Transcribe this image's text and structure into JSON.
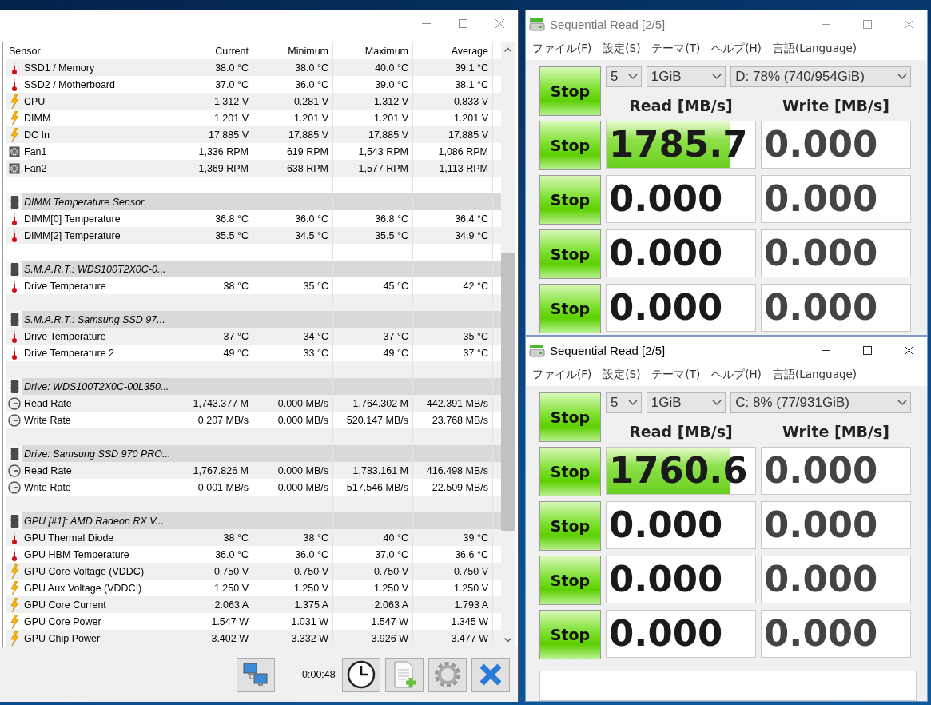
{
  "sensor_window": {
    "columns": [
      "Sensor",
      "Current",
      "Minimum",
      "Maximum",
      "Average"
    ],
    "rows": [
      {
        "kind": "temperature",
        "name": "SSD1 / Memory",
        "values": [
          "38.0 °C",
          "38.0 °C",
          "40.0 °C",
          "39.1 °C"
        ]
      },
      {
        "kind": "temperature",
        "name": "SSD2 / Motherboard",
        "values": [
          "37.0 °C",
          "36.0 °C",
          "39.0 °C",
          "38.1 °C"
        ]
      },
      {
        "kind": "voltage",
        "name": "CPU",
        "values": [
          "1.312 V",
          "0.281 V",
          "1.312 V",
          "0.833 V"
        ]
      },
      {
        "kind": "voltage",
        "name": "DIMM",
        "values": [
          "1.201 V",
          "1.201 V",
          "1.201 V",
          "1.201 V"
        ]
      },
      {
        "kind": "voltage",
        "name": "DC In",
        "values": [
          "17.885 V",
          "17.885 V",
          "17.885 V",
          "17.885 V"
        ]
      },
      {
        "kind": "fan",
        "name": "Fan1",
        "values": [
          "1,336 RPM",
          "619 RPM",
          "1,543 RPM",
          "1,086 RPM"
        ]
      },
      {
        "kind": "fan",
        "name": "Fan2",
        "values": [
          "1,369 RPM",
          "638 RPM",
          "1,577 RPM",
          "1,113 RPM"
        ]
      },
      {
        "kind": "blank"
      },
      {
        "kind": "group",
        "name": "DIMM Temperature Sensor"
      },
      {
        "kind": "temperature",
        "name": "DIMM[0] Temperature",
        "values": [
          "36.8 °C",
          "36.0 °C",
          "36.8 °C",
          "36.4 °C"
        ]
      },
      {
        "kind": "temperature",
        "name": "DIMM[2] Temperature",
        "values": [
          "35.5 °C",
          "34.5 °C",
          "35.5 °C",
          "34.9 °C"
        ]
      },
      {
        "kind": "blank"
      },
      {
        "kind": "group",
        "name": "S.M.A.R.T.: WDS100T2X0C-0..."
      },
      {
        "kind": "temperature",
        "name": "Drive Temperature",
        "values": [
          "38 °C",
          "35 °C",
          "45 °C",
          "42 °C"
        ]
      },
      {
        "kind": "blank"
      },
      {
        "kind": "group",
        "name": "S.M.A.R.T.: Samsung SSD 97..."
      },
      {
        "kind": "temperature",
        "name": "Drive Temperature",
        "values": [
          "37 °C",
          "34 °C",
          "37 °C",
          "35 °C"
        ]
      },
      {
        "kind": "temperature",
        "name": "Drive Temperature 2",
        "values": [
          "49 °C",
          "33 °C",
          "49 °C",
          "37 °C"
        ]
      },
      {
        "kind": "blank"
      },
      {
        "kind": "group",
        "name": "Drive: WDS100T2X0C-00L350..."
      },
      {
        "kind": "rate",
        "name": "Read Rate",
        "values": [
          "1,743.377 M",
          "0.000 MB/s",
          "1,764.302 M",
          "442.391 MB/s"
        ]
      },
      {
        "kind": "rate",
        "name": "Write Rate",
        "values": [
          "0.207 MB/s",
          "0.000 MB/s",
          "520.147 MB/s",
          "23.768 MB/s"
        ]
      },
      {
        "kind": "blank"
      },
      {
        "kind": "group",
        "name": "Drive: Samsung SSD 970 PRO..."
      },
      {
        "kind": "rate",
        "name": "Read Rate",
        "values": [
          "1,767.826 M",
          "0.000 MB/s",
          "1,783.161 M",
          "416.498 MB/s"
        ]
      },
      {
        "kind": "rate",
        "name": "Write Rate",
        "values": [
          "0.001 MB/s",
          "0.000 MB/s",
          "517.546 MB/s",
          "22.509 MB/s"
        ]
      },
      {
        "kind": "blank"
      },
      {
        "kind": "group",
        "name": "GPU [#1]: AMD Radeon RX V..."
      },
      {
        "kind": "temperature",
        "name": "GPU Thermal Diode",
        "values": [
          "38 °C",
          "38 °C",
          "40 °C",
          "39 °C"
        ]
      },
      {
        "kind": "temperature",
        "name": "GPU HBM Temperature",
        "values": [
          "36.0 °C",
          "36.0 °C",
          "37.0 °C",
          "36.6 °C"
        ]
      },
      {
        "kind": "voltage",
        "name": "GPU Core Voltage (VDDC)",
        "values": [
          "0.750 V",
          "0.750 V",
          "0.750 V",
          "0.750 V"
        ]
      },
      {
        "kind": "voltage",
        "name": "GPU Aux Voltage (VDDCI)",
        "values": [
          "1.250 V",
          "1.250 V",
          "1.250 V",
          "1.250 V"
        ]
      },
      {
        "kind": "voltage",
        "name": "GPU Core Current",
        "values": [
          "2.063 A",
          "1.375 A",
          "2.063 A",
          "1.793 A"
        ]
      },
      {
        "kind": "voltage",
        "name": "GPU Core Power",
        "values": [
          "1.547 W",
          "1.031 W",
          "1.547 W",
          "1.345 W"
        ]
      },
      {
        "kind": "voltage",
        "name": "GPU Chip Power",
        "values": [
          "3.402 W",
          "3.332 W",
          "3.926 W",
          "3.477 W"
        ]
      }
    ],
    "elapsed": "0:00:48"
  },
  "benchmark_windows": [
    {
      "title": "Sequential Read [2/5]",
      "active": false,
      "menu": [
        "ファイル(F)",
        "設定(S)",
        "テーマ(T)",
        "ヘルプ(H)",
        "言語(Language)"
      ],
      "all_button": "Stop",
      "runs": "5",
      "size": "1GiB",
      "drive": "D: 78% (740/954GiB)",
      "read_header": "Read [MB/s]",
      "write_header": "Write [MB/s]",
      "rows": [
        {
          "button": "Stop",
          "read": "1785.7",
          "level": 0.83,
          "write": "0.000"
        },
        {
          "button": "Stop",
          "read": "0.000",
          "level": 0,
          "write": "0.000"
        },
        {
          "button": "Stop",
          "read": "0.000",
          "level": 0,
          "write": "0.000"
        },
        {
          "button": "Stop",
          "read": "0.000",
          "level": 0,
          "write": "0.000"
        }
      ]
    },
    {
      "title": "Sequential Read [2/5]",
      "active": true,
      "menu": [
        "ファイル(F)",
        "設定(S)",
        "テーマ(T)",
        "ヘルプ(H)",
        "言語(Language)"
      ],
      "all_button": "Stop",
      "runs": "5",
      "size": "1GiB",
      "drive": "C: 8% (77/931GiB)",
      "read_header": "Read [MB/s]",
      "write_header": "Write [MB/s]",
      "rows": [
        {
          "button": "Stop",
          "read": "1760.6",
          "level": 0.83,
          "write": "0.000"
        },
        {
          "button": "Stop",
          "read": "0.000",
          "level": 0,
          "write": "0.000"
        },
        {
          "button": "Stop",
          "read": "0.000",
          "level": 0,
          "write": "0.000"
        },
        {
          "button": "Stop",
          "read": "0.000",
          "level": 0,
          "write": "0.000"
        }
      ]
    }
  ]
}
